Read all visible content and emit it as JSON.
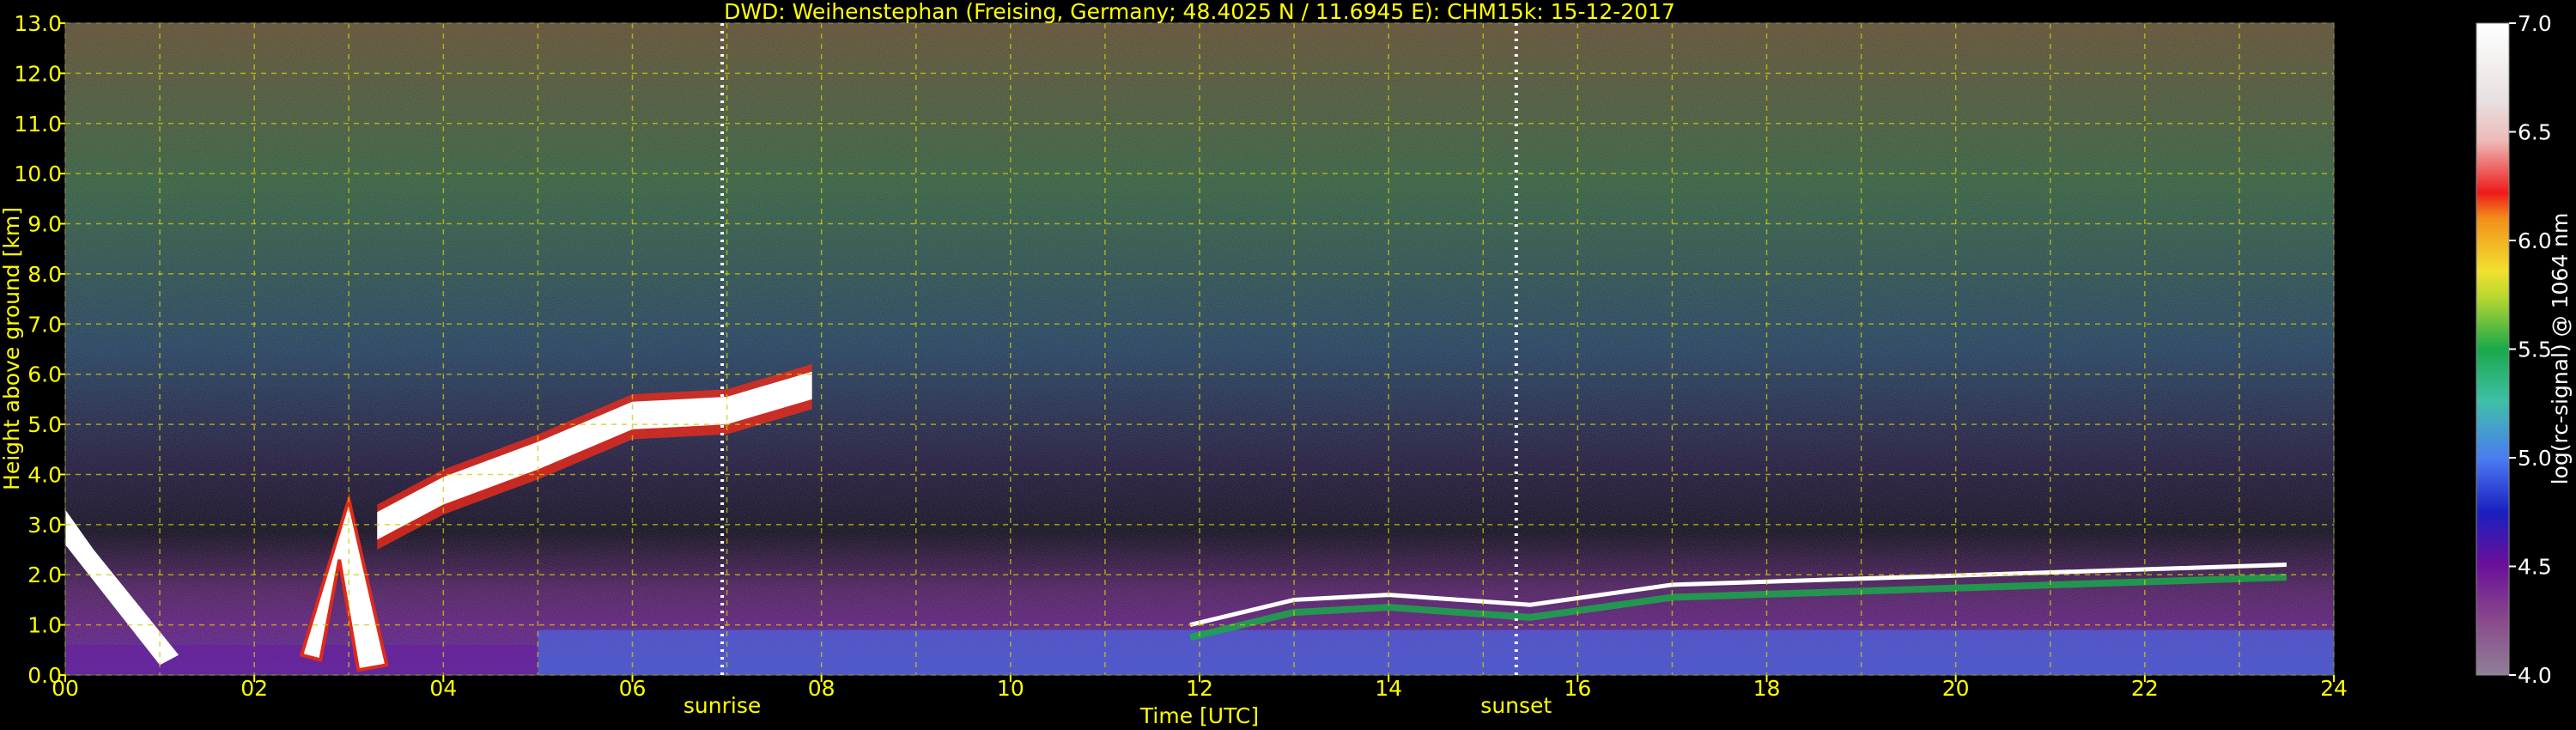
{
  "chart_data": {
    "type": "heatmap",
    "title": "DWD: Weihenstephan (Freising, Germany; 48.4025 N / 11.6945 E):    CHM15k: 15-12-2017",
    "xlabel": "Time [UTC]",
    "ylabel": "Height above ground [km]",
    "xlim": [
      0,
      24
    ],
    "ylim": [
      0,
      13
    ],
    "x_ticks": [
      "00",
      "02",
      "04",
      "06",
      "08",
      "10",
      "12",
      "14",
      "16",
      "18",
      "20",
      "22",
      "24"
    ],
    "y_ticks": [
      "0.0",
      "1.0",
      "2.0",
      "3.0",
      "4.0",
      "5.0",
      "6.0",
      "7.0",
      "8.0",
      "9.0",
      "10.0",
      "11.0",
      "12.0",
      "13.0"
    ],
    "grid": true,
    "annotations": [
      {
        "label": "sunrise",
        "x": 6.95
      },
      {
        "label": "sunset",
        "x": 15.35
      }
    ],
    "colorbar": {
      "label": "log(rc-signal) @ 1064 nm",
      "range": [
        4.0,
        7.0
      ],
      "ticks": [
        "4.0",
        "4.5",
        "5.0",
        "5.5",
        "6.0",
        "6.5",
        "7.0"
      ]
    },
    "cloud_layer_top_km": [
      {
        "x": 3.3,
        "y": 3.4
      },
      {
        "x": 4.0,
        "y": 4.1
      },
      {
        "x": 5.0,
        "y": 4.8
      },
      {
        "x": 6.0,
        "y": 5.6
      },
      {
        "x": 7.0,
        "y": 5.7
      },
      {
        "x": 7.9,
        "y": 6.2
      }
    ],
    "low_cloud_top_km": [
      {
        "x": 11.9,
        "y": 1.0
      },
      {
        "x": 13.0,
        "y": 1.5
      },
      {
        "x": 14.0,
        "y": 1.6
      },
      {
        "x": 15.5,
        "y": 1.4
      },
      {
        "x": 17.0,
        "y": 1.8
      },
      {
        "x": 23.5,
        "y": 2.2
      }
    ],
    "boundary_layer_top_km": 0.9
  },
  "colors": {
    "text": "#ffff00",
    "grid": "#cccc00",
    "colorbar_text": "#ffffff"
  }
}
